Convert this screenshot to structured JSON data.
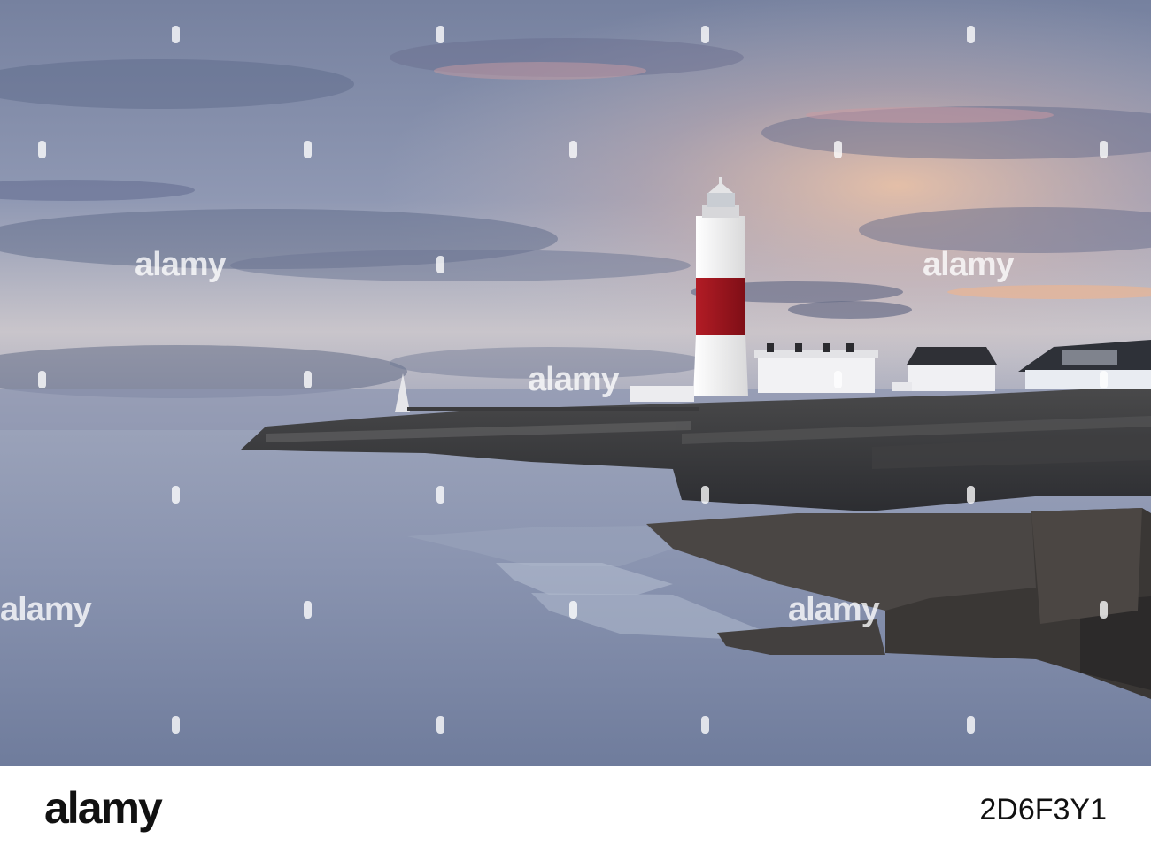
{
  "watermark": {
    "text": "alamy"
  },
  "footer": {
    "logo_text": "alamy",
    "image_code": "2D6F3Y1"
  },
  "colors": {
    "sky_top": "#7a86a8",
    "sky_horizon": "#d7cbc7",
    "sunset_glow": "#e8b49a",
    "sea": "#7e8aa8",
    "lighthouse_red": "#a3161f",
    "lighthouse_white": "#f2f1ee",
    "rock": "#3a3a3c"
  }
}
